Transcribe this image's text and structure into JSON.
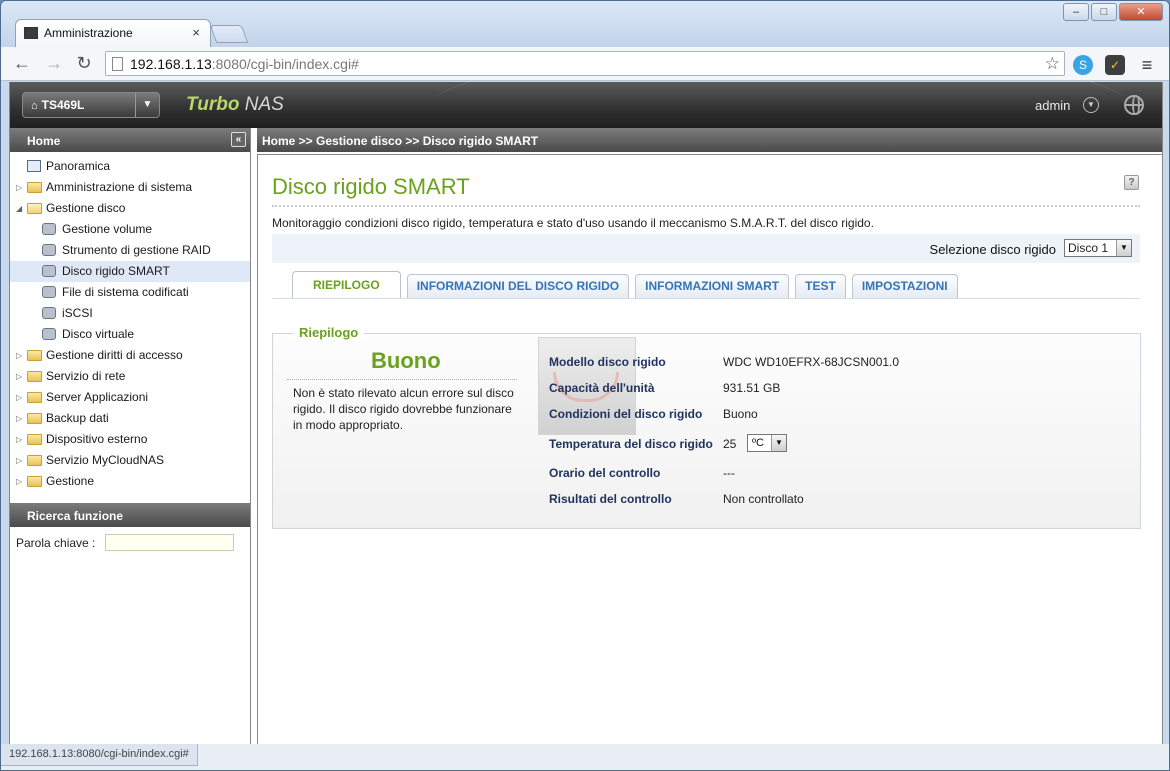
{
  "browser": {
    "tab_title": "Amministrazione",
    "tab_close": "×",
    "url_host": "192.168.1.13",
    "url_rest": ":8080/cgi-bin/index.cgi#",
    "status_url": "192.168.1.13:8080/cgi-bin/index.cgi#",
    "back": "←",
    "forward": "→",
    "reload": "↻",
    "star": "☆",
    "menu": "≡",
    "min": "–",
    "max": "□",
    "close": "✕"
  },
  "header": {
    "model": "TS469L",
    "brand_bold": "Turbo",
    "brand_rest": "NAS",
    "user": "admin"
  },
  "sidebar": {
    "title": "Home",
    "collapse": "«",
    "items": [
      {
        "label": "Panoramica"
      },
      {
        "label": "Amministrazione di sistema"
      },
      {
        "label": "Gestione disco"
      },
      {
        "label": "Gestione volume"
      },
      {
        "label": "Strumento di gestione RAID"
      },
      {
        "label": "Disco rigido SMART"
      },
      {
        "label": "File di sistema codificati"
      },
      {
        "label": "iSCSI"
      },
      {
        "label": "Disco virtuale"
      },
      {
        "label": "Gestione diritti di accesso"
      },
      {
        "label": "Servizio di rete"
      },
      {
        "label": "Server Applicazioni"
      },
      {
        "label": "Backup dati"
      },
      {
        "label": "Dispositivo esterno"
      },
      {
        "label": "Servizio MyCloudNAS"
      },
      {
        "label": "Gestione"
      }
    ],
    "search": {
      "title": "Ricerca funzione",
      "label": "Parola chiave :",
      "value": ""
    }
  },
  "breadcrumb": "Home >> Gestione disco >> Disco rigido SMART",
  "page": {
    "title": "Disco rigido SMART",
    "help": "?",
    "description": "Monitoraggio condizioni disco rigido, temperatura e stato d'uso usando il meccanismo S.M.A.R.T. del disco rigido.",
    "disk_select_label": "Selezione disco rigido",
    "disk_select_value": "Disco 1",
    "tabs": [
      {
        "label": "RIEPILOGO"
      },
      {
        "label": "INFORMAZIONI DEL DISCO RIGIDO"
      },
      {
        "label": "INFORMAZIONI SMART"
      },
      {
        "label": "TEST"
      },
      {
        "label": "IMPOSTAZIONI"
      }
    ],
    "summary": {
      "legend": "Riepilogo",
      "status": "Buono",
      "status_desc": "Non è stato rilevato alcun errore sul disco rigido. Il disco rigido dovrebbe funzionare in modo appropriato.",
      "rows": [
        {
          "label": "Modello disco rigido",
          "value": "WDC WD10EFRX-68JCSN001.0"
        },
        {
          "label": "Capacità dell'unità",
          "value": "931.51 GB"
        },
        {
          "label": "Condizioni del disco rigido",
          "value": "Buono"
        },
        {
          "label": "Temperatura del disco rigido",
          "value": "25"
        },
        {
          "label": "Orario del controllo",
          "value": "---"
        },
        {
          "label": "Risultati del controllo",
          "value": "Non controllato"
        }
      ],
      "temp_unit": "ºC"
    }
  }
}
